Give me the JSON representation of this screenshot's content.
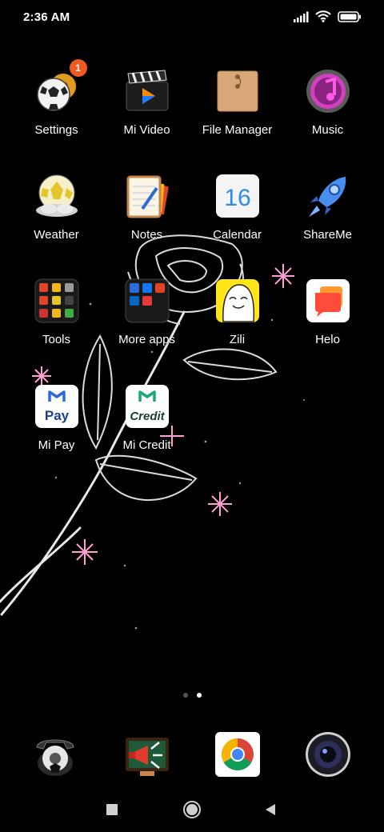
{
  "status_bar": {
    "time": "2:36 AM",
    "icons": [
      "signal-icon",
      "wifi-icon",
      "battery-icon"
    ]
  },
  "apps": [
    {
      "label": "Settings",
      "icon": "settings-icon",
      "badge": "1"
    },
    {
      "label": "Mi Video",
      "icon": "mi-video-icon"
    },
    {
      "label": "File Manager",
      "icon": "file-manager-icon"
    },
    {
      "label": "Music",
      "icon": "music-icon"
    },
    {
      "label": "Weather",
      "icon": "weather-icon"
    },
    {
      "label": "Notes",
      "icon": "notes-icon"
    },
    {
      "label": "Calendar",
      "icon": "calendar-icon",
      "icon_text": "16"
    },
    {
      "label": "ShareMe",
      "icon": "shareme-icon"
    },
    {
      "label": "Tools",
      "icon": "tools-folder-icon"
    },
    {
      "label": "More apps",
      "icon": "more-apps-folder-icon"
    },
    {
      "label": "Zili",
      "icon": "zili-icon"
    },
    {
      "label": "Helo",
      "icon": "helo-icon"
    },
    {
      "label": "Mi Pay",
      "icon": "mi-pay-icon",
      "icon_text": "Pay"
    },
    {
      "label": "Mi Credit",
      "icon": "mi-credit-icon",
      "icon_text": "Credit"
    }
  ],
  "page_indicator": {
    "count": 2,
    "active": 2
  },
  "dock": [
    {
      "icon": "phone-icon"
    },
    {
      "icon": "messages-icon"
    },
    {
      "icon": "chrome-icon"
    },
    {
      "icon": "camera-icon"
    }
  ],
  "nav_bar": [
    "recents-button",
    "home-button",
    "back-button"
  ],
  "colors": {
    "background": "#000000",
    "badge": "#f05a1e",
    "mi_green": "#19a974",
    "mi_blue": "#2f6bd8"
  }
}
